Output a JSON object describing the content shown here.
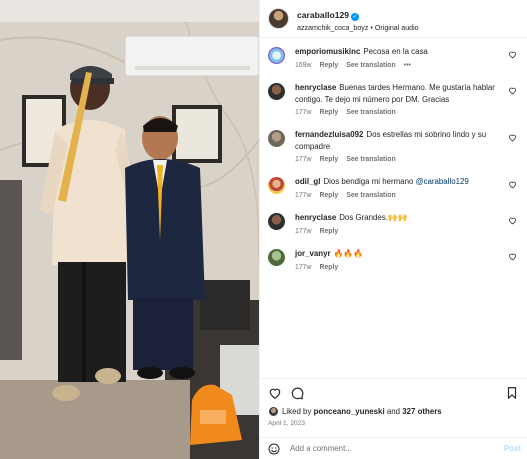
{
  "post": {
    "username": "caraballo129",
    "audio_user": "azzamchik_coca_boyz",
    "audio_sep": "•",
    "audio_title": "Original audio"
  },
  "comments": [
    {
      "user": "emporiomusikinc",
      "text": "Pecosa en la casa",
      "time": "169w",
      "reply": "Reply",
      "translate": "See translation",
      "more": "•••",
      "avatar_color": "#c8e6f5"
    },
    {
      "user": "henryclase",
      "text": "Buenas tardes Hermano. Me gustaría hablar contigo. Te dejo mi número por DM. Gracias",
      "time": "177w",
      "reply": "Reply",
      "translate": "See translation",
      "avatar_color": "#6b4a3a"
    },
    {
      "user": "fernandezluisa092",
      "text": "Dos estrellas mi sobrino lindo y su compadre",
      "time": "177w",
      "reply": "Reply",
      "translate": "See translation",
      "avatar_color": "#8a8f7a"
    },
    {
      "user": "odil_gl",
      "text": "Dios bendiga mi hermano",
      "mention": "@caraballo129",
      "time": "177w",
      "reply": "Reply",
      "translate": "See translation",
      "avatar_color": "#d9a35c"
    },
    {
      "user": "henryclase",
      "text": "Dos Grandes.🙌🙌",
      "time": "177w",
      "reply": "Reply",
      "avatar_color": "#6b4a3a"
    },
    {
      "user": "jor_vanyr",
      "text": "🔥🔥🔥",
      "time": "177w",
      "reply": "Reply",
      "avatar_color": "#5f7a4e"
    }
  ],
  "likes": {
    "prefix": "Liked by",
    "user": "ponceano_yuneski",
    "mid": "and",
    "count": "327 others"
  },
  "date": "April 1, 2023",
  "composer": {
    "placeholder": "Add a comment...",
    "post_label": "Post"
  },
  "icons": {
    "verified": "verified-badge-icon",
    "heart": "heart-icon",
    "comment": "comment-bubble-icon",
    "bookmark": "bookmark-icon",
    "emoji": "emoji-smile-icon"
  },
  "colors": {
    "accent": "#0095f6",
    "post_disabled": "#b3dbff",
    "meta": "#737373"
  }
}
